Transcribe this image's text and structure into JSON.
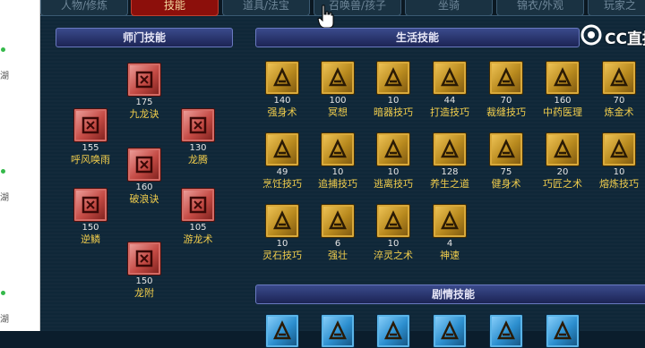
{
  "tabs": [
    "人物/修炼",
    "技能",
    "道具/法宝",
    "召唤兽/孩子",
    "坐骑",
    "锦衣/外观",
    "玩家之"
  ],
  "active_tab": "技能",
  "watermark": "CC直播",
  "sidebar_chars": [
    "湖",
    "湖",
    "湖"
  ],
  "sections": {
    "shimen": "师门技能",
    "shenghuo": "生活技能",
    "juqing": "剧情技能"
  },
  "shimen_skills": [
    {
      "level": "175",
      "name": "九龙诀"
    },
    {
      "level": "155",
      "name": "呼风唤雨"
    },
    {
      "level": "130",
      "name": "龙腾"
    },
    {
      "level": "160",
      "name": "破浪诀"
    },
    {
      "level": "150",
      "name": "逆鳞"
    },
    {
      "level": "105",
      "name": "游龙术"
    },
    {
      "level": "150",
      "name": "龙附"
    }
  ],
  "life_skills": [
    {
      "level": "140",
      "name": "强身术"
    },
    {
      "level": "100",
      "name": "冥想"
    },
    {
      "level": "10",
      "name": "暗器技巧"
    },
    {
      "level": "44",
      "name": "打造技巧"
    },
    {
      "level": "70",
      "name": "裁缝技巧"
    },
    {
      "level": "160",
      "name": "中药医理"
    },
    {
      "level": "70",
      "name": "炼金术"
    },
    {
      "level": "49",
      "name": "烹饪技巧"
    },
    {
      "level": "10",
      "name": "追捕技巧"
    },
    {
      "level": "10",
      "name": "逃离技巧"
    },
    {
      "level": "128",
      "name": "养生之道"
    },
    {
      "level": "75",
      "name": "健身术"
    },
    {
      "level": "20",
      "name": "巧匠之术"
    },
    {
      "level": "10",
      "name": "熔炼技巧"
    },
    {
      "level": "10",
      "name": "灵石技巧"
    },
    {
      "level": "6",
      "name": "强壮"
    },
    {
      "level": "10",
      "name": "淬灵之术"
    },
    {
      "level": "4",
      "name": "神速"
    }
  ],
  "colors": {
    "background": "#0f2738",
    "skill_name": "#f1cd4c",
    "active_tab": "#8c0f0b",
    "gold_icon": "#d9a93a",
    "red_icon": "#c44a44",
    "blue_icon": "#2c8fcf"
  }
}
